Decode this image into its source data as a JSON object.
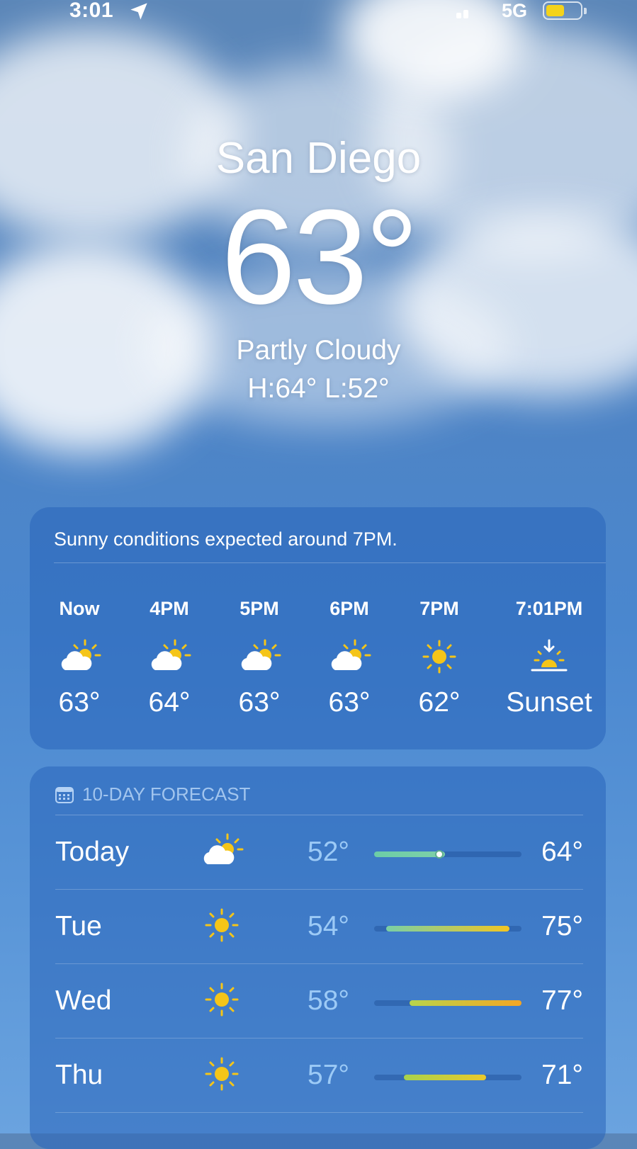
{
  "status_bar": {
    "time": "3:01",
    "network": "5G",
    "battery_level": 0.55
  },
  "location": {
    "city": "San Diego"
  },
  "current": {
    "temperature": "63°",
    "condition": "Partly Cloudy",
    "high_low": "H:64°  L:52°"
  },
  "hourly": {
    "summary": "Sunny conditions expected around 7PM.",
    "items": [
      {
        "label": "Now",
        "icon": "partly-cloudy-icon",
        "value": "63°"
      },
      {
        "label": "4PM",
        "icon": "partly-cloudy-icon",
        "value": "64°"
      },
      {
        "label": "5PM",
        "icon": "partly-cloudy-icon",
        "value": "63°"
      },
      {
        "label": "6PM",
        "icon": "partly-cloudy-icon",
        "value": "63°"
      },
      {
        "label": "7PM",
        "icon": "sun-icon",
        "value": "62°"
      },
      {
        "label": "7:01PM",
        "icon": "sunset-icon",
        "value": "Sunset"
      }
    ]
  },
  "daily": {
    "header": "10-DAY FORECAST",
    "range_min": 52,
    "range_max": 77,
    "days": [
      {
        "day": "Today",
        "icon": "partly-cloudy-icon",
        "low": "52°",
        "high": "64°",
        "low_value": 52,
        "high_value": 64,
        "current_value": 63,
        "gradient": [
          "#6ccda7",
          "#7ed0a8"
        ]
      },
      {
        "day": "Tue",
        "icon": "sun-icon",
        "low": "54°",
        "high": "75°",
        "low_value": 54,
        "high_value": 75,
        "gradient": [
          "#79cfa6",
          "#f2c622"
        ]
      },
      {
        "day": "Wed",
        "icon": "sun-icon",
        "low": "58°",
        "high": "77°",
        "low_value": 58,
        "high_value": 77,
        "gradient": [
          "#b8d44b",
          "#f5a623"
        ]
      },
      {
        "day": "Thu",
        "icon": "sun-icon",
        "low": "57°",
        "high": "71°",
        "low_value": 57,
        "high_value": 71,
        "gradient": [
          "#a8d24d",
          "#ebc92a"
        ]
      }
    ]
  },
  "colors": {
    "sun": "#f5c518",
    "cloud": "#ffffff",
    "low_temp": "#9ccaf6",
    "header": "#b4d2f5"
  }
}
